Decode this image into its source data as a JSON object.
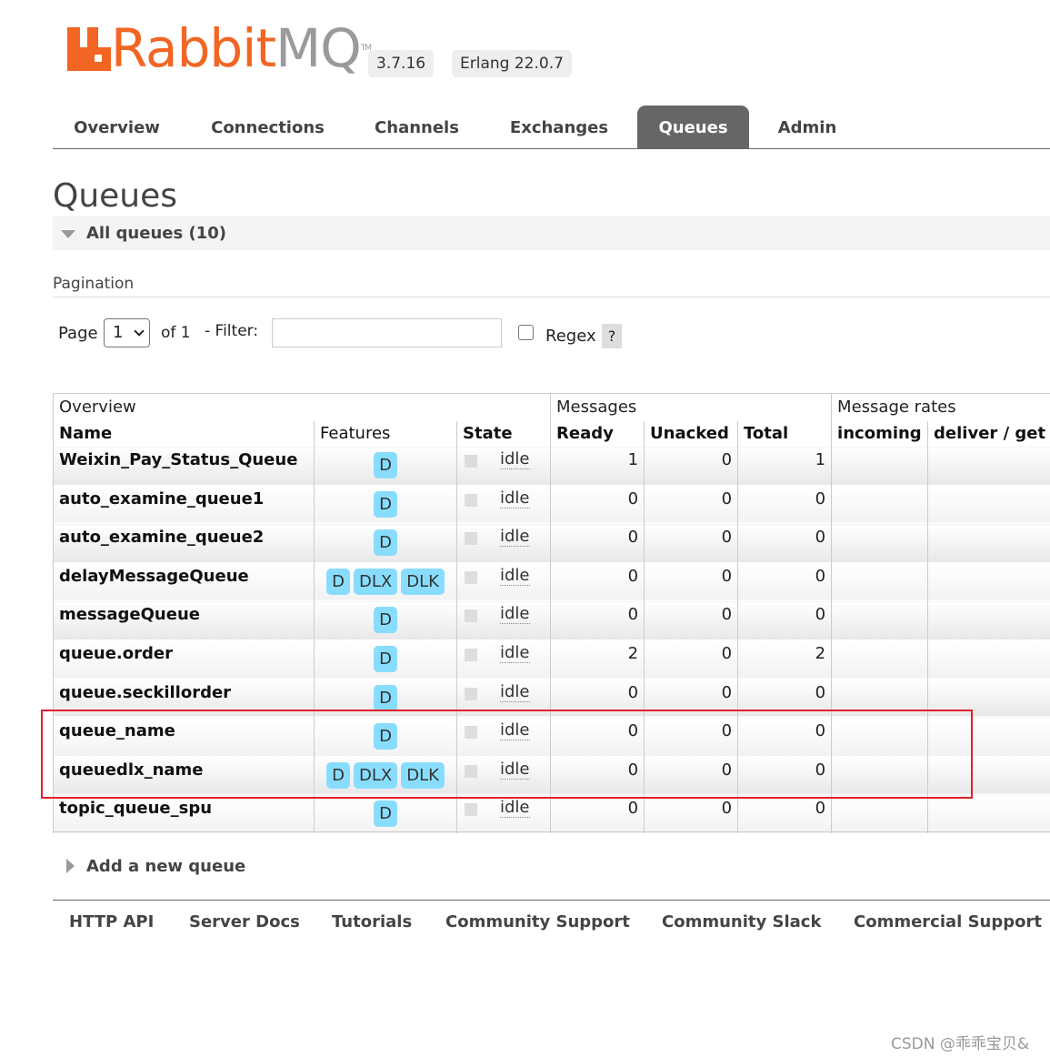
{
  "header": {
    "logo_prefix": "Rabbit",
    "logo_suffix": "MQ",
    "logo_tm": "TM",
    "version": "3.7.16",
    "erlang": "Erlang 22.0.7"
  },
  "tabs": [
    {
      "label": "Overview"
    },
    {
      "label": "Connections"
    },
    {
      "label": "Channels"
    },
    {
      "label": "Exchanges"
    },
    {
      "label": "Queues",
      "active": true
    },
    {
      "label": "Admin"
    }
  ],
  "page_title": "Queues",
  "section_title": "All queues (10)",
  "pagination": {
    "heading": "Pagination",
    "page_label": "Page",
    "page_value": "1",
    "of_label": "of 1",
    "filter_label": "- Filter:",
    "filter_value": "",
    "regex_label": "Regex",
    "help_label": "?"
  },
  "table": {
    "groups": [
      "Overview",
      "Messages",
      "Message rates"
    ],
    "columns": [
      "Name",
      "Features",
      "State",
      "Ready",
      "Unacked",
      "Total",
      "incoming",
      "deliver / get"
    ],
    "rows": [
      {
        "name": "Weixin_Pay_Status_Queue",
        "features": [
          "D"
        ],
        "state": "idle",
        "ready": "1",
        "unacked": "0",
        "total": "1"
      },
      {
        "name": "auto_examine_queue1",
        "features": [
          "D"
        ],
        "state": "idle",
        "ready": "0",
        "unacked": "0",
        "total": "0"
      },
      {
        "name": "auto_examine_queue2",
        "features": [
          "D"
        ],
        "state": "idle",
        "ready": "0",
        "unacked": "0",
        "total": "0"
      },
      {
        "name": "delayMessageQueue",
        "features": [
          "D",
          "DLX",
          "DLK"
        ],
        "state": "idle",
        "ready": "0",
        "unacked": "0",
        "total": "0"
      },
      {
        "name": "messageQueue",
        "features": [
          "D"
        ],
        "state": "idle",
        "ready": "0",
        "unacked": "0",
        "total": "0"
      },
      {
        "name": "queue.order",
        "features": [
          "D"
        ],
        "state": "idle",
        "ready": "2",
        "unacked": "0",
        "total": "2"
      },
      {
        "name": "queue.seckillorder",
        "features": [
          "D"
        ],
        "state": "idle",
        "ready": "0",
        "unacked": "0",
        "total": "0"
      },
      {
        "name": "queue_name",
        "features": [
          "D"
        ],
        "state": "idle",
        "ready": "0",
        "unacked": "0",
        "total": "0"
      },
      {
        "name": "queuedlx_name",
        "features": [
          "D",
          "DLX",
          "DLK"
        ],
        "state": "idle",
        "ready": "0",
        "unacked": "0",
        "total": "0"
      },
      {
        "name": "topic_queue_spu",
        "features": [
          "D"
        ],
        "state": "idle",
        "ready": "0",
        "unacked": "0",
        "total": "0"
      }
    ]
  },
  "add_queue_label": "Add a new queue",
  "footer": [
    "HTTP API",
    "Server Docs",
    "Tutorials",
    "Community Support",
    "Community Slack",
    "Commercial Support"
  ],
  "watermark": "CSDN @乖乖宝贝&",
  "colors": {
    "brand_orange": "#f26522",
    "badge_blue": "#88ddff",
    "active_tab": "#666666",
    "highlight_red": "#e0202a"
  }
}
